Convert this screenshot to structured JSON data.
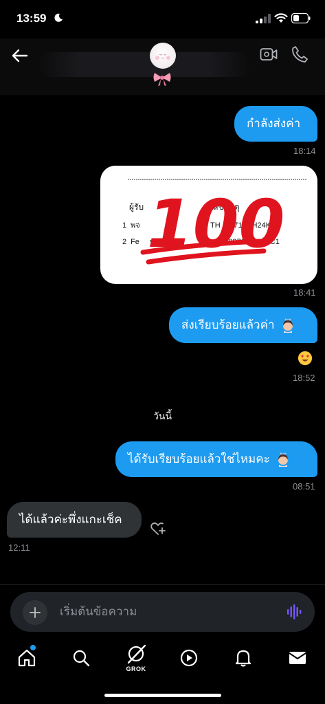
{
  "status_bar": {
    "time": "13:59"
  },
  "messages": [
    {
      "text": "กำลังส่งค่า",
      "time": "18:14"
    },
    {
      "image_text": {
        "watermark": "100",
        "col1": "ผู้รับ",
        "col2": "เลขพัสดุ",
        "row1_idx": "1",
        "row1_name": "พจ",
        "row1_track": "TH",
        "row1_track_end": "0171TPH24K",
        "row2_idx": "2",
        "row2_name": "Fe",
        "row2_name_end": "y",
        "row2_track": "040271TPHC2C1"
      },
      "time": "18:41"
    },
    {
      "text": "ส่งเรียบร้อยแล้วค่า",
      "time": "18:52"
    },
    {
      "text": "ได้รับเรียบร้อยแล้วใช่ไหมคะ",
      "time": "08:51"
    },
    {
      "text": "ได้แล้วค่ะพึ่งแกะเช็ค",
      "time": "12:11"
    }
  ],
  "day_separator": "วันนี้",
  "composer": {
    "placeholder": "เริ่มต้นข้อความ"
  },
  "tabbar": {
    "grok_label": "GROK"
  },
  "colors": {
    "outgoing_bubble": "#1d9bf0",
    "incoming_bubble": "#2f3336",
    "background": "#000000",
    "timestamp": "#8b8f94"
  },
  "icons": [
    "back-arrow-icon",
    "video-call-icon",
    "phone-call-icon",
    "plus-icon",
    "voice-wave-icon",
    "home-icon",
    "search-icon",
    "grok-icon",
    "play-icon",
    "bell-icon",
    "mail-icon",
    "heart-plus-icon",
    "heart-eyes-emoji",
    "princess-emoji",
    "pink-bow-icon"
  ]
}
